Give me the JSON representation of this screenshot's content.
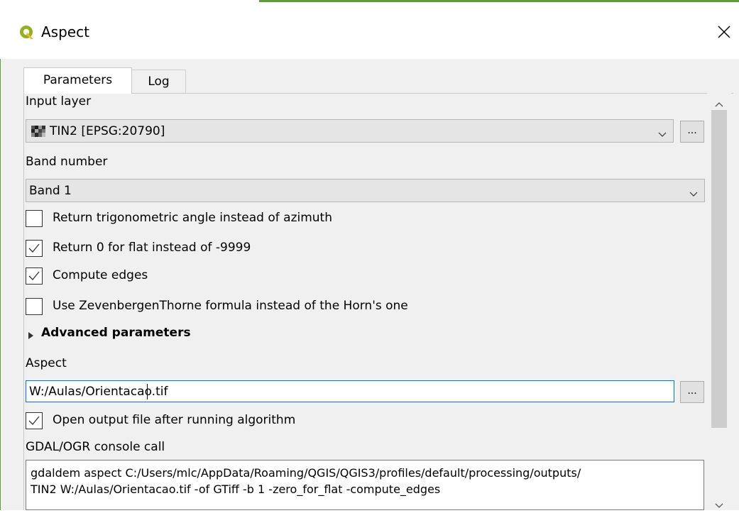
{
  "window": {
    "title": "Aspect",
    "app_icon": "qgis-logo-icon",
    "close_icon": "close-icon"
  },
  "tabs": [
    {
      "label": "Parameters",
      "active": true
    },
    {
      "label": "Log",
      "active": false
    }
  ],
  "params": {
    "input_layer": {
      "label": "Input layer",
      "value": "TIN2 [EPSG:20790]",
      "icon": "raster-layer-icon",
      "browse": "..."
    },
    "band_number": {
      "label": "Band number",
      "value": "Band 1"
    },
    "checkboxes": [
      {
        "label": "Return trigonometric angle instead of azimuth",
        "checked": false
      },
      {
        "label": "Return 0 for flat instead of -9999",
        "checked": true
      },
      {
        "label": "Compute edges",
        "checked": true
      },
      {
        "label": "Use ZevenbergenThorne formula instead of the Horn's one",
        "checked": false
      }
    ],
    "advanced": {
      "label": "Advanced parameters",
      "icon": "expand-triangle-icon"
    },
    "output": {
      "label": "Aspect",
      "value": "W:/Aulas/Orientacao.tif",
      "browse": "..."
    },
    "open_output": {
      "label": "Open output file after running algorithm",
      "checked": true
    },
    "console": {
      "label": "GDAL/OGR console call",
      "line1": "gdaldem aspect C:/Users/mlc/AppData/Roaming/QGIS/QGIS3/profiles/default/processing/outputs/",
      "line2": "TIN2 W:/Aulas/Orientacao.tif -of GTiff -b 1 -zero_for_flat -compute_edges"
    }
  },
  "colors": {
    "accent": "#5c9e3c",
    "focus": "#0078d7",
    "dialog_bg": "#f0f0f0"
  }
}
